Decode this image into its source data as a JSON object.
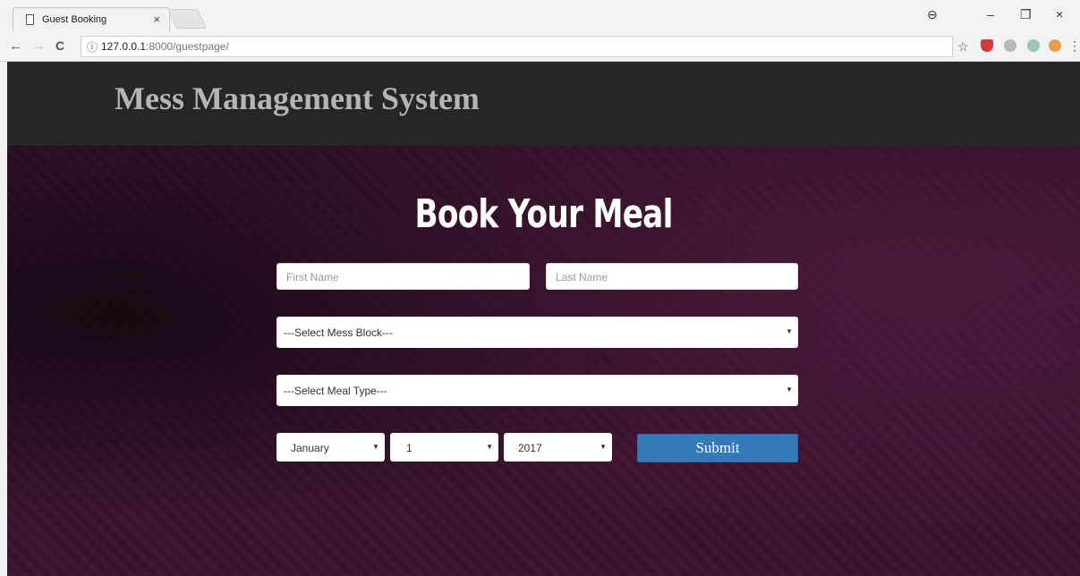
{
  "browser": {
    "tab_title": "Guest Booking",
    "tab_close": "×",
    "url_host": "127.0.0.1",
    "url_rest": ":8000/guestpage/",
    "info_glyph": "ⓘ",
    "back": "←",
    "forward": "→",
    "reload": "C",
    "star": "☆",
    "account": "⊖",
    "minimize": "–",
    "restore": "❐",
    "close": "×",
    "menu": "⋮"
  },
  "header": {
    "brand": "Mess Management System"
  },
  "form": {
    "heading": "Book Your Meal",
    "first_name_placeholder": "First Name",
    "last_name_placeholder": "Last Name",
    "mess_block_selected": "---Select Mess Block---",
    "meal_type_selected": "---Select Meal Type---",
    "month_selected": "January",
    "day_selected": "1",
    "year_selected": "2017",
    "submit_label": "Submit",
    "caret": "▼"
  },
  "colors": {
    "submit": "#337ab7",
    "header": "#262626",
    "background": "#3a1430"
  }
}
